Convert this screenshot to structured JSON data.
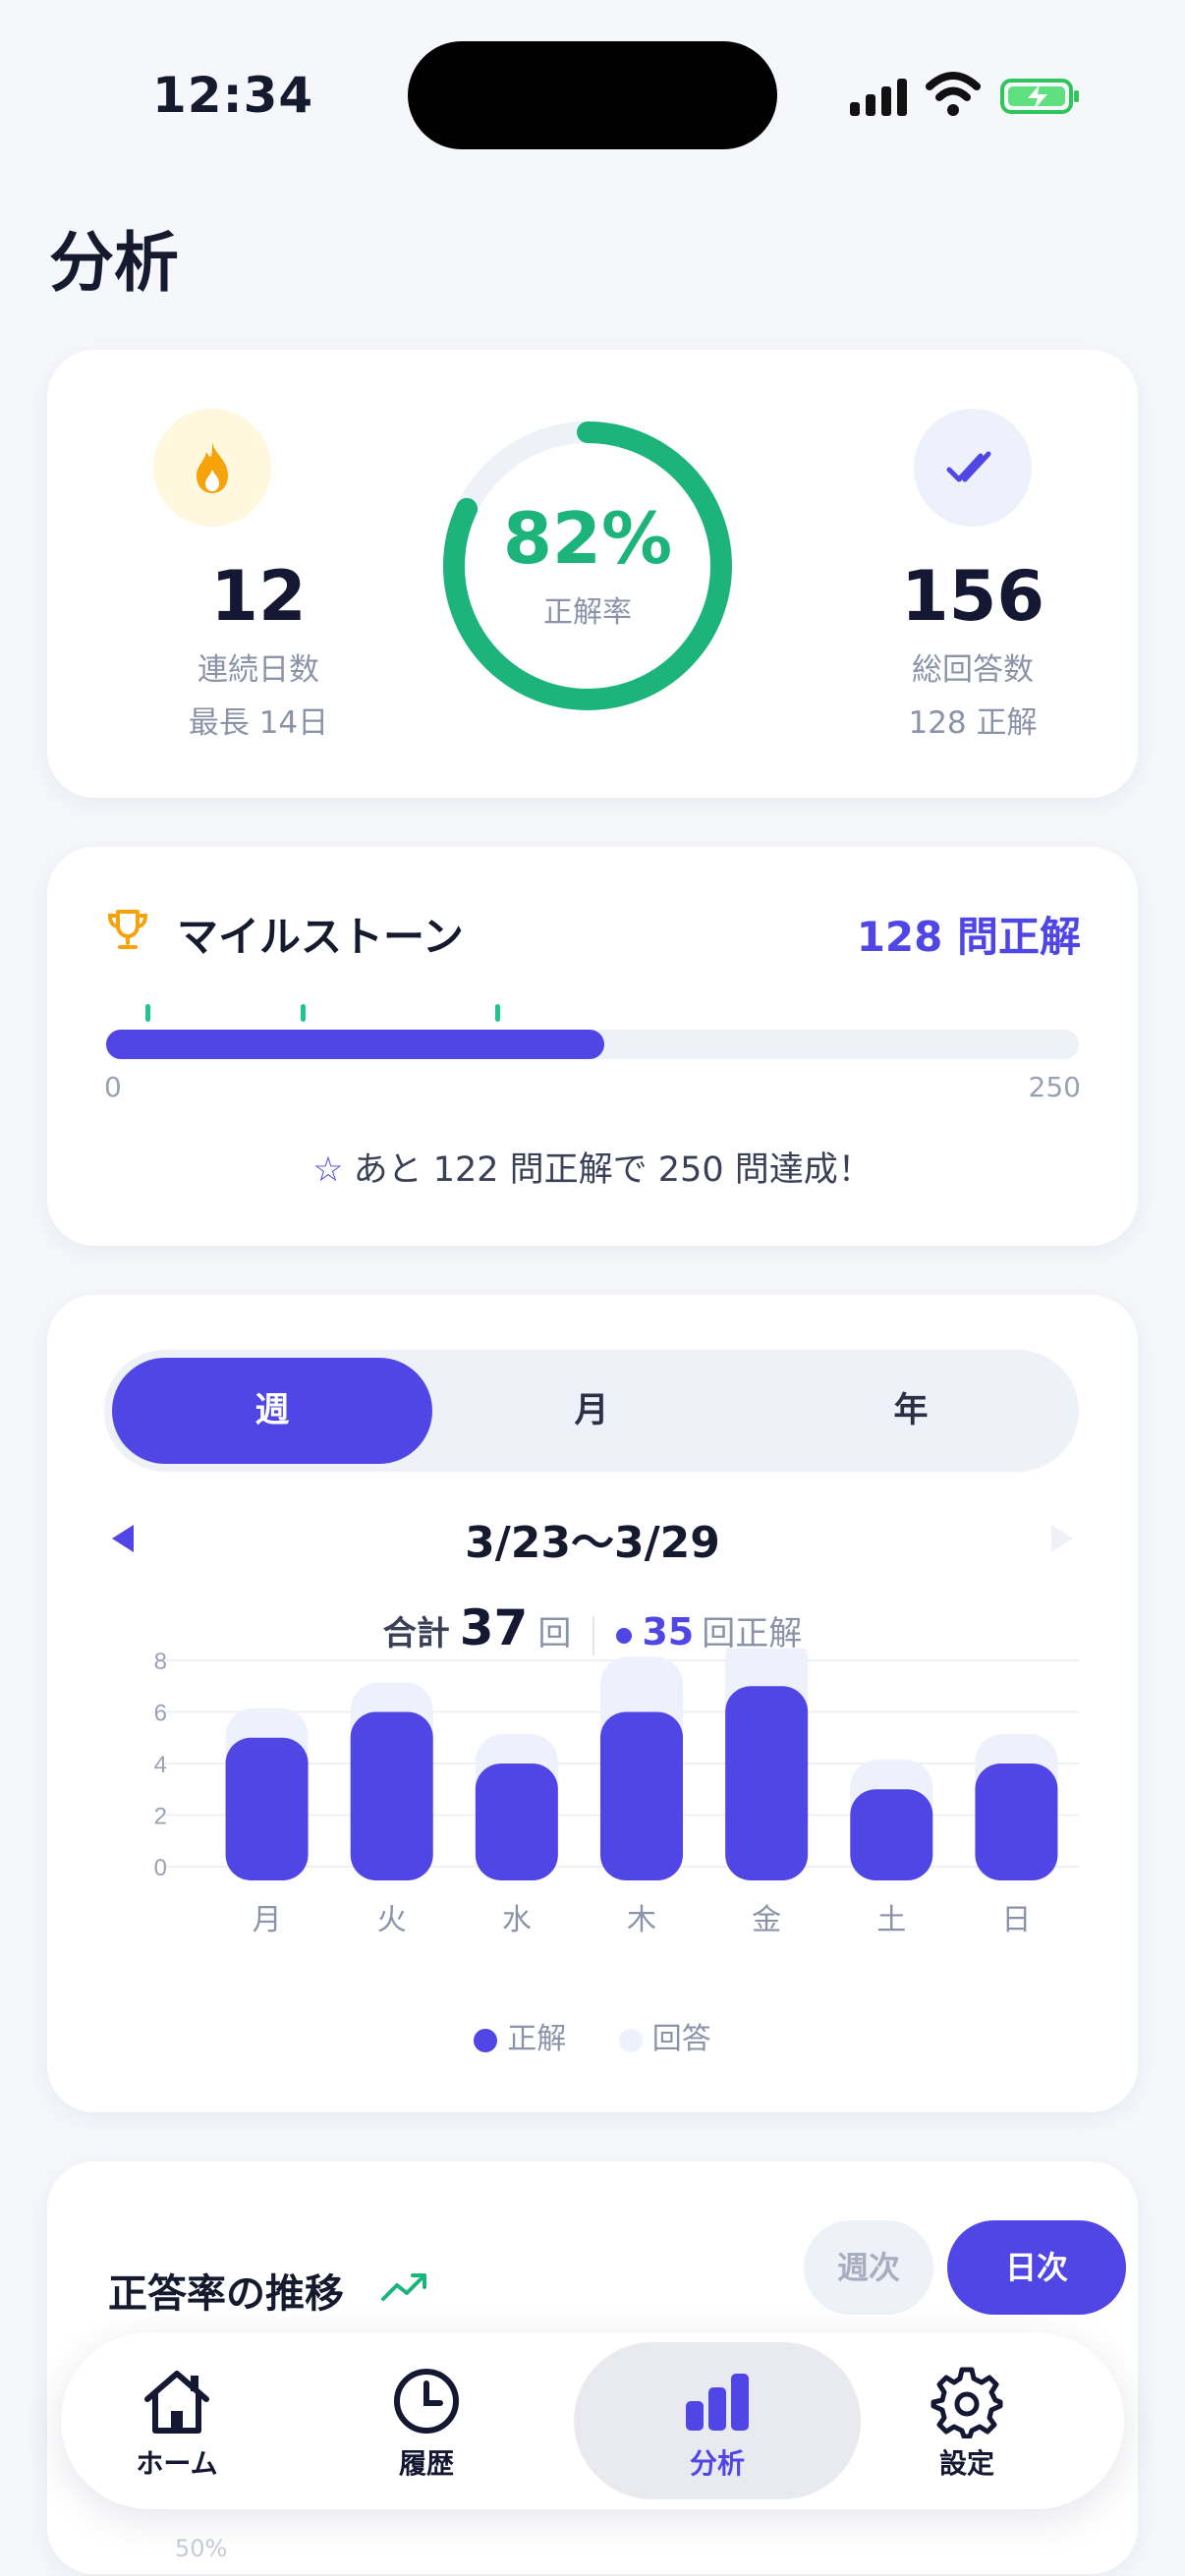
{
  "status_bar": {
    "time": "12:34"
  },
  "page": {
    "title": "分析"
  },
  "stats": {
    "streak": {
      "value": "12",
      "label": "連続日数",
      "sub": "最長 14日"
    },
    "accuracy": {
      "value": "82%",
      "label": "正解率",
      "percent": 82
    },
    "answers": {
      "value": "156",
      "label": "総回答数",
      "sub": "128 正解"
    }
  },
  "milestone": {
    "title": "マイルストーン",
    "status": "128 問正解",
    "min": "0",
    "max": "250",
    "progress": 0.512,
    "message": "あと 122 問正解で 250 問達成！"
  },
  "period_selector": {
    "options": [
      "週",
      "月",
      "年"
    ],
    "selected": "週"
  },
  "chart_header": {
    "range": "3/23〜3/29",
    "total_label": "合計",
    "total_value": "37",
    "total_unit": "回",
    "correct_value": "35",
    "correct_unit": "回正解"
  },
  "chart_data": {
    "type": "bar",
    "categories": [
      "月",
      "火",
      "水",
      "木",
      "金",
      "土",
      "日"
    ],
    "series": [
      {
        "name": "正解",
        "values": [
          5,
          6,
          4,
          6,
          7,
          3,
          4
        ],
        "color": "#4f46e5"
      },
      {
        "name": "回答",
        "values": [
          5,
          6,
          4,
          7,
          8,
          3,
          4
        ],
        "color": "#eef1fc"
      }
    ],
    "yticks": [
      "0",
      "2",
      "4",
      "6",
      "8"
    ],
    "ylim": [
      0,
      8
    ],
    "legend_position": "bottom"
  },
  "trend": {
    "title": "正答率の推移",
    "buttons": [
      "週次",
      "日次"
    ],
    "selected": "日次",
    "faint_label": "50%"
  },
  "tabbar": {
    "tabs": [
      {
        "label": "ホーム",
        "icon": "home-icon"
      },
      {
        "label": "履歴",
        "icon": "clock-icon"
      },
      {
        "label": "分析",
        "icon": "bar-chart-icon"
      },
      {
        "label": "設定",
        "icon": "gear-icon"
      }
    ],
    "active": "分析"
  },
  "colors": {
    "accent": "#4f46e5",
    "green": "#1db47c",
    "flame": "#f5a20b"
  }
}
